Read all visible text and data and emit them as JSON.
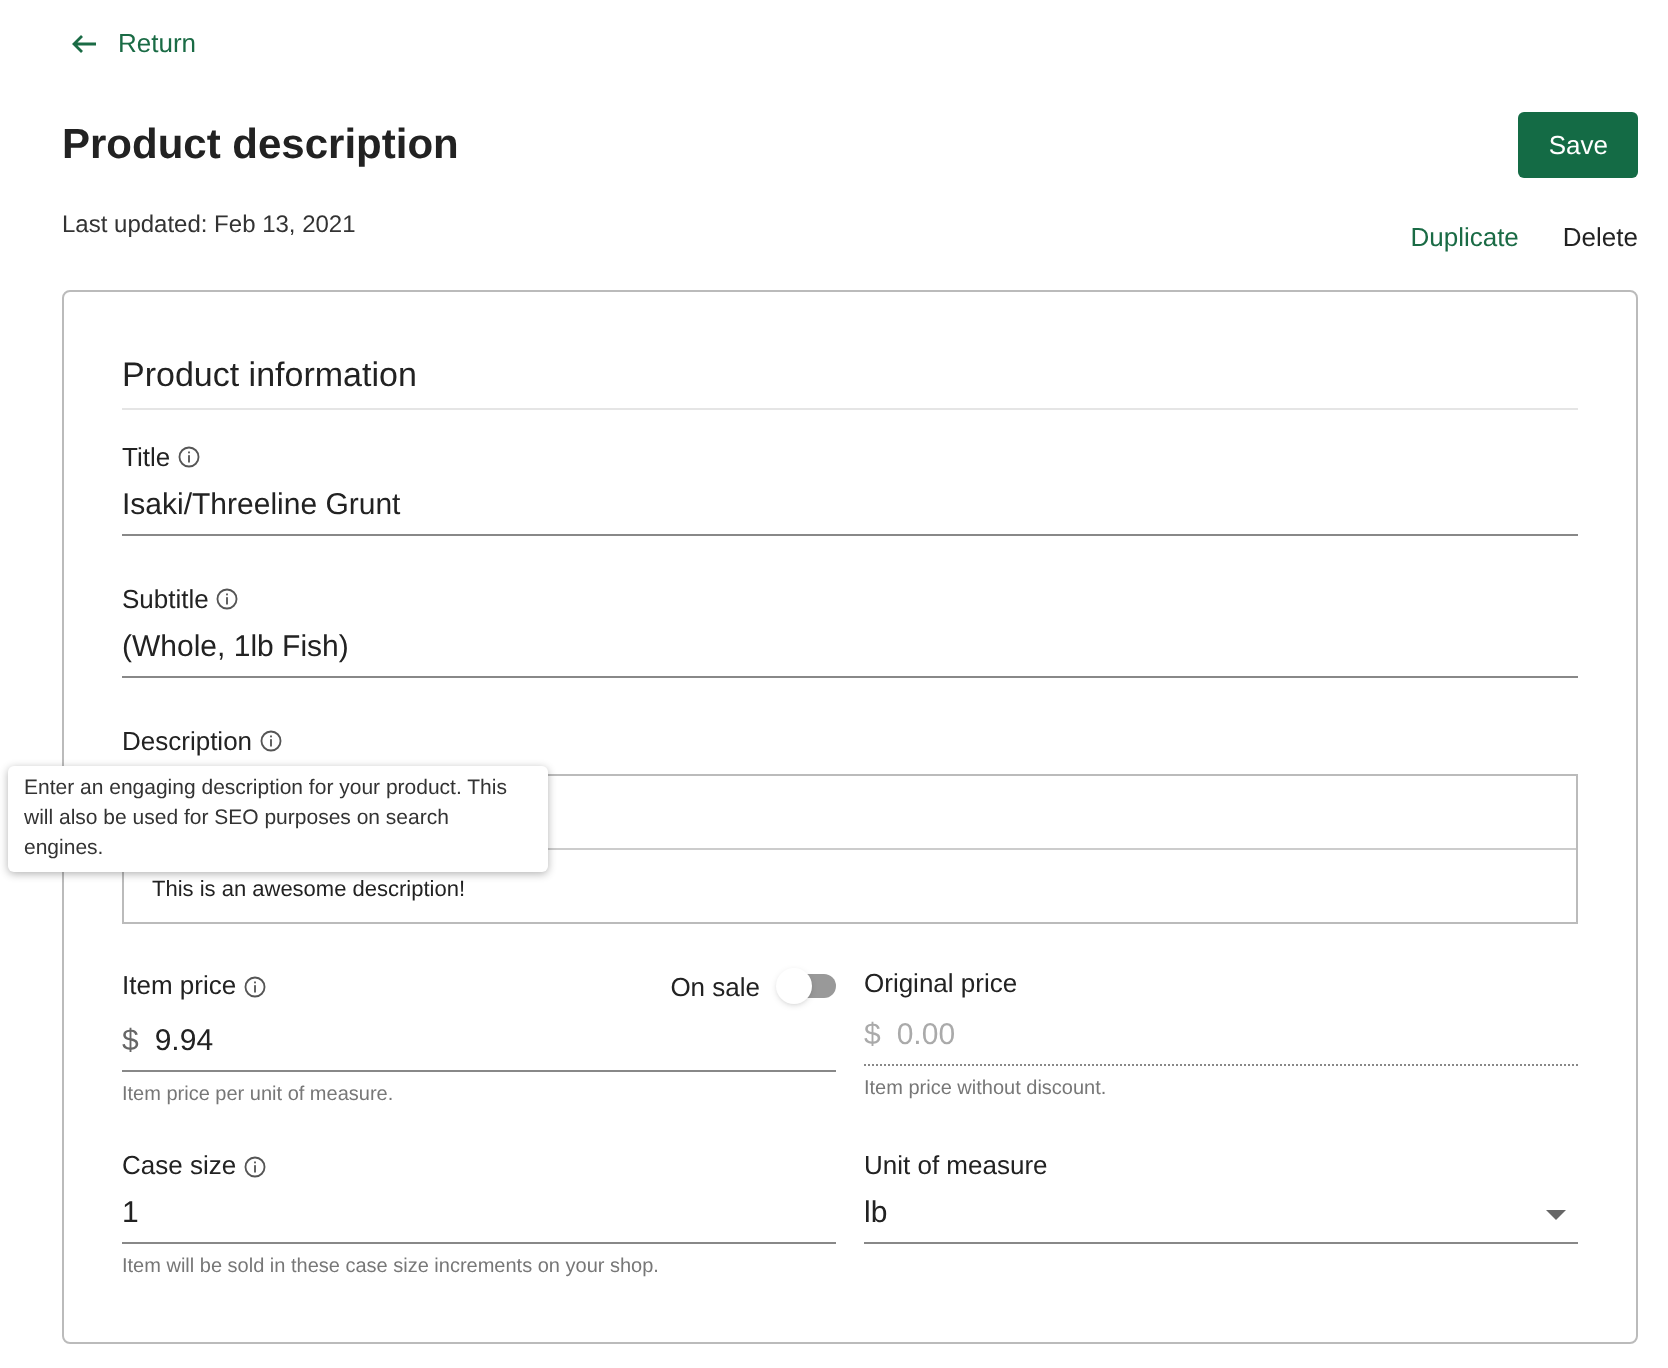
{
  "return_link": "Return",
  "page_title": "Product description",
  "save_button": "Save",
  "last_updated": "Last updated: Feb 13, 2021",
  "actions": [
    {
      "label": "Duplicate",
      "kind": "primary"
    },
    {
      "label": "Delete",
      "kind": "plain"
    }
  ],
  "section_title": "Product information",
  "title_field": {
    "label": "Title",
    "value": "Isaki/Threeline Grunt"
  },
  "subtitle_field": {
    "label": "Subtitle",
    "value": "(Whole, 1lb Fish)"
  },
  "description_field": {
    "label": "Description",
    "value": "This is an awesome description!",
    "tooltip": "Enter an engaging description for your product. This will also be used for SEO purposes on search engines."
  },
  "item_price": {
    "label": "Item price",
    "currency": "$",
    "value": "9.94",
    "help": "Item price per unit of measure."
  },
  "on_sale": {
    "label": "On sale",
    "on": false
  },
  "original_price": {
    "label": "Original price",
    "currency": "$",
    "placeholder": "0.00",
    "help": "Item price without discount.",
    "disabled": true
  },
  "case_size": {
    "label": "Case size",
    "value": "1",
    "help": "Item will be sold in these case size increments on your shop."
  },
  "unit_of_measure": {
    "label": "Unit of measure",
    "value": "lb"
  }
}
